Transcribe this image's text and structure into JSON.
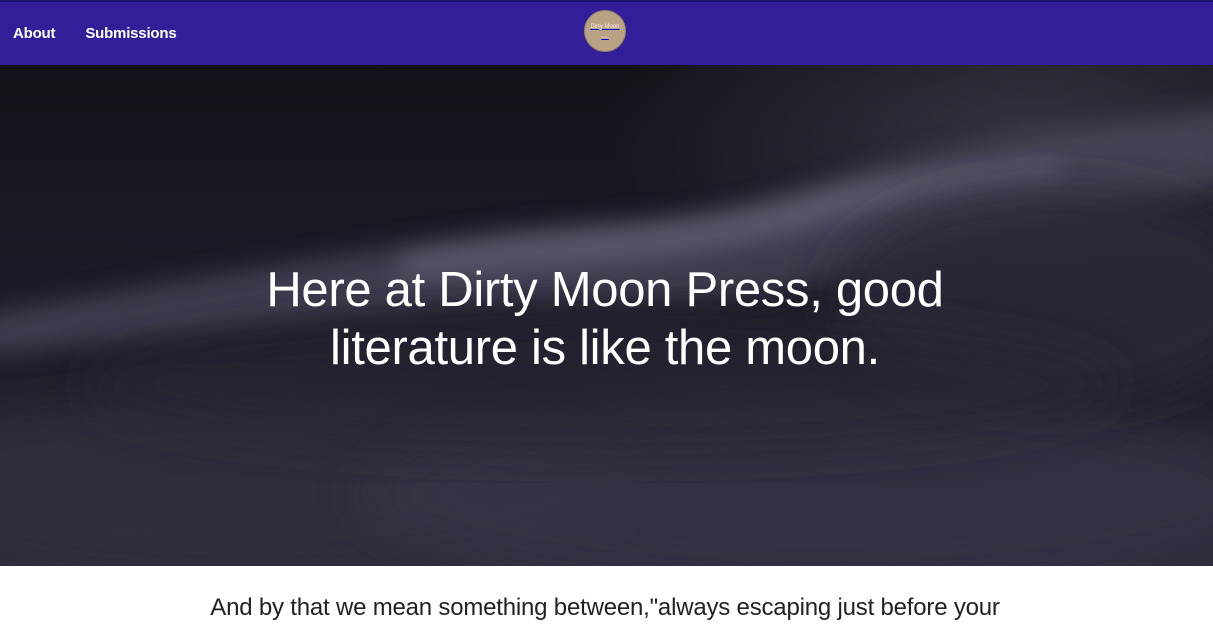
{
  "nav": {
    "items": [
      {
        "label": "About"
      },
      {
        "label": "Submissions"
      }
    ]
  },
  "logo": {
    "text": "Dirty Moon",
    "subtext": "press",
    "background": "#b9a184"
  },
  "header": {
    "background": "#331e9a"
  },
  "hero": {
    "heading": "Here at Dirty Moon Press, good literature is like the moon."
  },
  "intro": {
    "text": "And by that we mean something between,\"always escaping just before your"
  }
}
